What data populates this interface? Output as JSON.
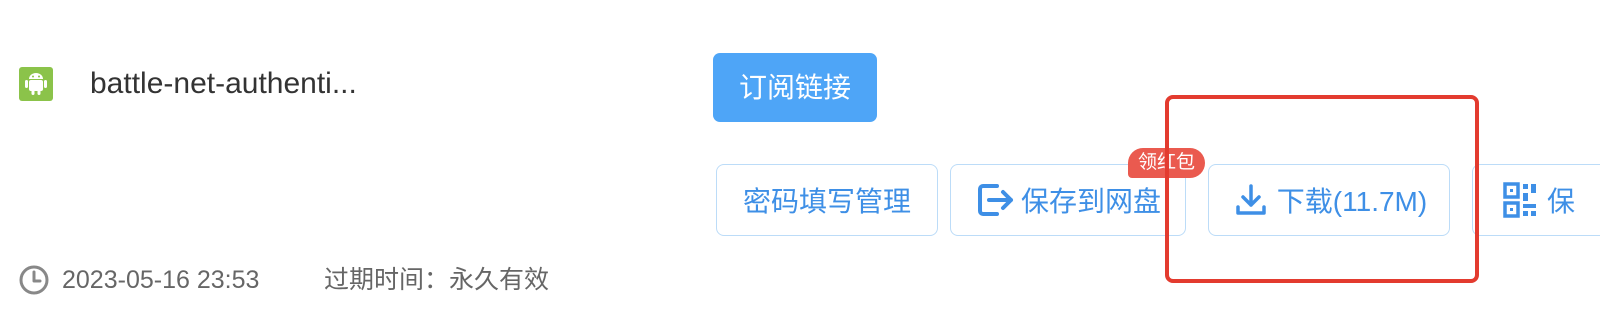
{
  "file": {
    "icon": "android-icon",
    "name": "battle-net-authenti..."
  },
  "subscribe": {
    "label": "订阅链接"
  },
  "actions": {
    "password_label": "密码填写管理",
    "save_label": "保存到网盘",
    "save_icon": "save-to-cloud-icon",
    "download_label": "下载(11.7M)",
    "download_icon": "download-icon",
    "more_label": "保",
    "more_icon": "qr-code-icon"
  },
  "badge": {
    "label": "领红包"
  },
  "meta": {
    "date": "2023-05-16 23:53",
    "expire": "过期时间：永久有效"
  },
  "colors": {
    "accent": "#4ea5f7",
    "button_text": "#3e8fe6",
    "highlight": "#e33b2f",
    "badge": "#ea5a4f",
    "file_icon": "#8bc34a"
  }
}
